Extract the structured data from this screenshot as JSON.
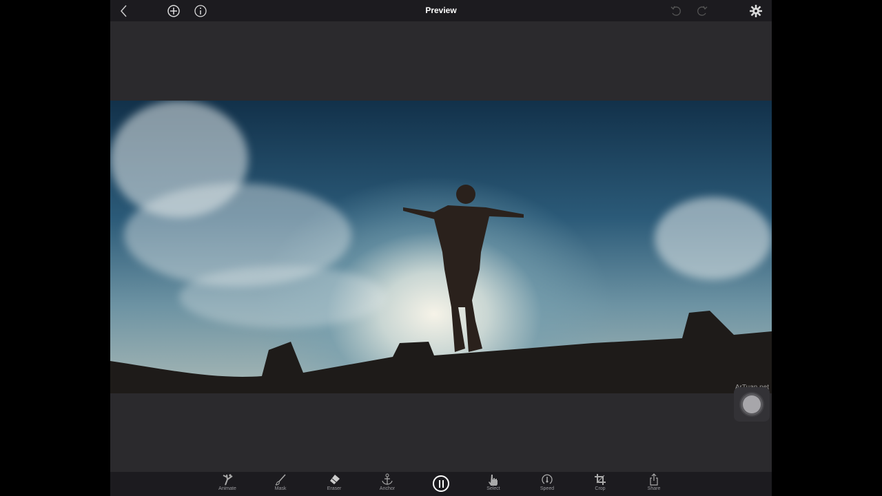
{
  "header": {
    "title": "Preview",
    "icons": [
      "back-icon",
      "add-icon",
      "info-icon",
      "undo-icon",
      "redo-icon",
      "settings-icon"
    ]
  },
  "photo": {
    "watermark": "ArTuan.net"
  },
  "toolbar": {
    "items": [
      {
        "label": "Animate",
        "icon": "dancer-icon"
      },
      {
        "label": "Mask",
        "icon": "brush-icon"
      },
      {
        "label": "Eraser",
        "icon": "eraser-icon"
      },
      {
        "label": "Anchor",
        "icon": "anchor-icon"
      },
      {
        "label": "Select",
        "icon": "hand-icon"
      },
      {
        "label": "Speed",
        "icon": "speedometer-icon"
      },
      {
        "label": "Crop",
        "icon": "crop-icon"
      },
      {
        "label": "Share",
        "icon": "share-icon"
      }
    ]
  }
}
